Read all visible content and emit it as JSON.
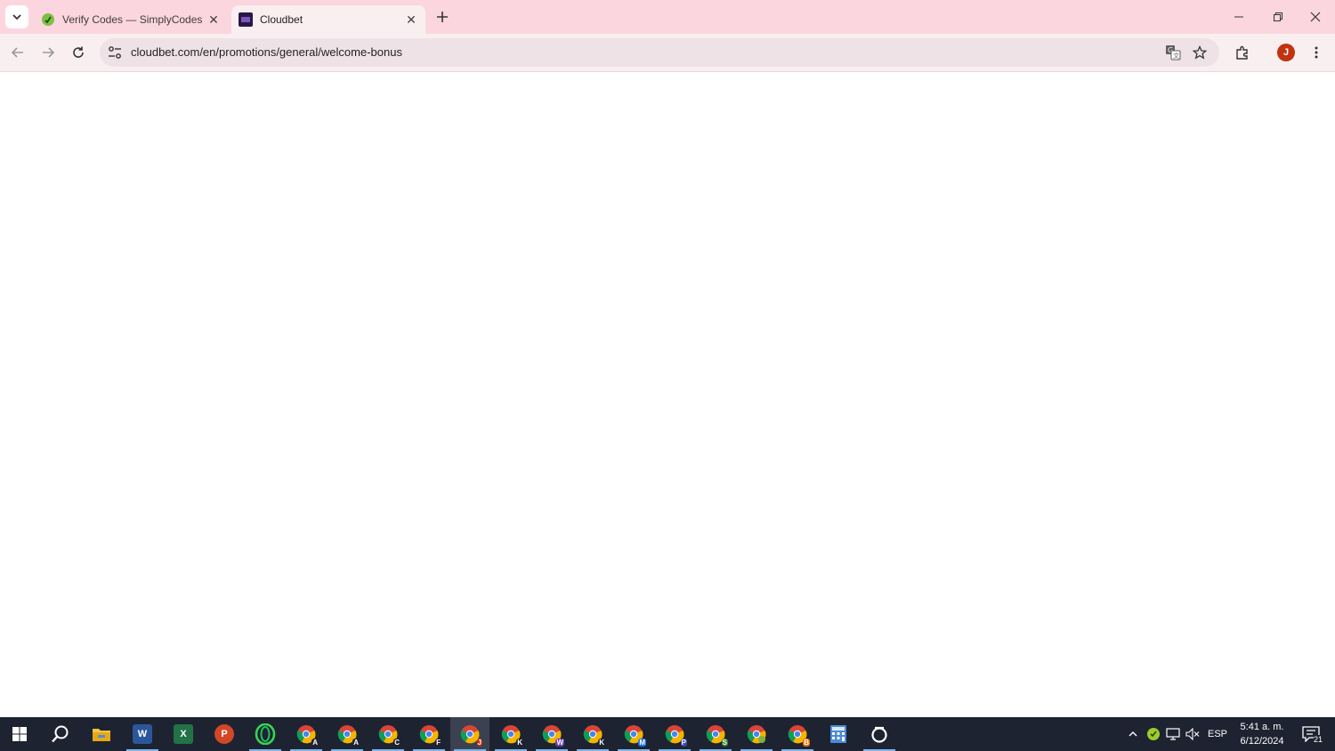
{
  "browser": {
    "tabs": [
      {
        "title": "Verify Codes — SimplyCodes",
        "favicon": "simplycodes-leaf-icon",
        "active": false
      },
      {
        "title": "Cloudbet",
        "favicon": "cloudbet-icon",
        "active": true
      }
    ],
    "new_tab_label": "+",
    "address": "cloudbet.com/en/promotions/general/welcome-bonus",
    "profile_initial": "J"
  },
  "taskbar": {
    "apps": [
      {
        "name": "start",
        "icon": "windows-start-icon"
      },
      {
        "name": "search",
        "icon": "search-icon"
      },
      {
        "name": "file-explorer",
        "icon": "folder-icon"
      },
      {
        "name": "word",
        "icon": "word-icon",
        "letter": "W",
        "color": "#2b579a"
      },
      {
        "name": "excel",
        "icon": "excel-icon",
        "letter": "X",
        "color": "#217346"
      },
      {
        "name": "powerpoint",
        "icon": "powerpoint-icon",
        "letter": "P",
        "color": "#d24726"
      },
      {
        "name": "opera",
        "icon": "opera-icon"
      },
      {
        "name": "chrome-a",
        "icon": "chrome-icon",
        "letter": "A"
      },
      {
        "name": "chrome-a2",
        "icon": "chrome-icon",
        "letter": "A"
      },
      {
        "name": "chrome-c",
        "icon": "chrome-icon",
        "letter": "C"
      },
      {
        "name": "chrome-f",
        "icon": "chrome-icon",
        "letter": "F"
      },
      {
        "name": "chrome-j",
        "icon": "chrome-icon",
        "letter": "J"
      },
      {
        "name": "chrome-k",
        "icon": "chrome-icon",
        "letter": "K"
      },
      {
        "name": "chrome-w",
        "icon": "chrome-icon",
        "letter": "W"
      },
      {
        "name": "chrome-k2",
        "icon": "chrome-icon",
        "letter": "K"
      },
      {
        "name": "chrome-m",
        "icon": "chrome-icon",
        "letter": "M"
      },
      {
        "name": "chrome-p",
        "icon": "chrome-icon",
        "letter": "P"
      },
      {
        "name": "chrome-s",
        "icon": "chrome-icon",
        "letter": "S"
      },
      {
        "name": "chrome-g",
        "icon": "chrome-icon",
        "letter": ""
      },
      {
        "name": "chrome-b",
        "icon": "chrome-icon",
        "letter": "B"
      },
      {
        "name": "calculator",
        "icon": "calculator-icon"
      },
      {
        "name": "other",
        "icon": "ring-icon"
      }
    ],
    "tray": {
      "language": "ESP",
      "time": "5:41 a. m.",
      "date": "6/12/2024",
      "notifications": "21"
    }
  }
}
